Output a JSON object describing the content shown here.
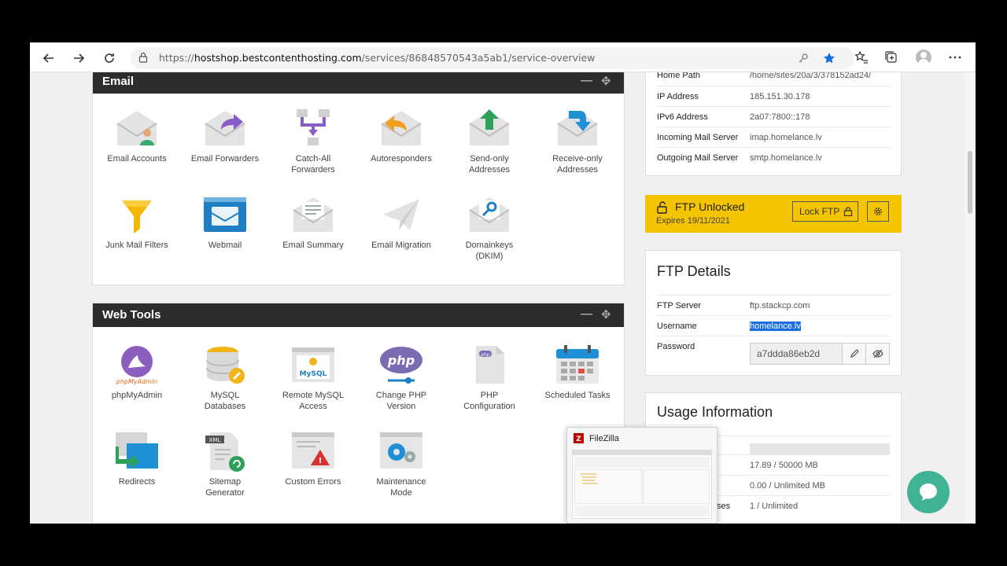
{
  "browser": {
    "url_prefix": "https://",
    "url_host": "hostshop.bestcontenthosting.com",
    "url_path": "/services/86848570543a5ab1/service-overview"
  },
  "email_panel": {
    "title": "Email",
    "tiles": [
      {
        "label": "Email Accounts"
      },
      {
        "label": "Email Forwarders"
      },
      {
        "label": "Catch-All\nForwarders"
      },
      {
        "label": "Autoresponders"
      },
      {
        "label": "Send-only\nAddresses"
      },
      {
        "label": "Receive-only\nAddresses"
      },
      {
        "label": "Junk Mail Filters"
      },
      {
        "label": "Webmail"
      },
      {
        "label": "Email Summary"
      },
      {
        "label": "Email Migration"
      },
      {
        "label": "Domainkeys\n(DKIM)"
      }
    ]
  },
  "webtools_panel": {
    "title": "Web Tools",
    "tiles": [
      {
        "label": "phpMyAdmin"
      },
      {
        "label": "MySQL\nDatabases"
      },
      {
        "label": "Remote MySQL\nAccess"
      },
      {
        "label": "Change PHP\nVersion"
      },
      {
        "label": "PHP\nConfiguration"
      },
      {
        "label": "Scheduled Tasks"
      },
      {
        "label": "Redirects"
      },
      {
        "label": "Sitemap\nGenerator"
      },
      {
        "label": "Custom Errors"
      },
      {
        "label": "Maintenance\nMode"
      }
    ]
  },
  "server_info": [
    {
      "k": "Home Path",
      "v": "/home/sites/20a/3/378152ad24/"
    },
    {
      "k": "IP Address",
      "v": "185.151.30.178"
    },
    {
      "k": "IPv6 Address",
      "v": "2a07:7800::178"
    },
    {
      "k": "Incoming Mail Server",
      "v": "imap.homelance.lv"
    },
    {
      "k": "Outgoing Mail Server",
      "v": "smtp.homelance.lv"
    }
  ],
  "ftp_banner": {
    "title": "FTP Unlocked",
    "expires": "Expires 19/11/2021",
    "lock_label": "Lock FTP",
    "color": "#f5c400"
  },
  "ftp_details": {
    "title": "FTP Details",
    "server_label": "FTP Server",
    "server": "ftp.stackcp.com",
    "username_label": "Username",
    "username": "homelance.lv",
    "password_label": "Password",
    "password": "a7ddda86eb2d"
  },
  "usage": {
    "title": "Usage Information",
    "disk": "17.89 / 50000 MB",
    "bandwidth": "0.00 / Unlimited MB",
    "ses_label": "ses",
    "databases": "1 / Unlimited"
  },
  "filezilla": {
    "title": "FileZilla"
  }
}
